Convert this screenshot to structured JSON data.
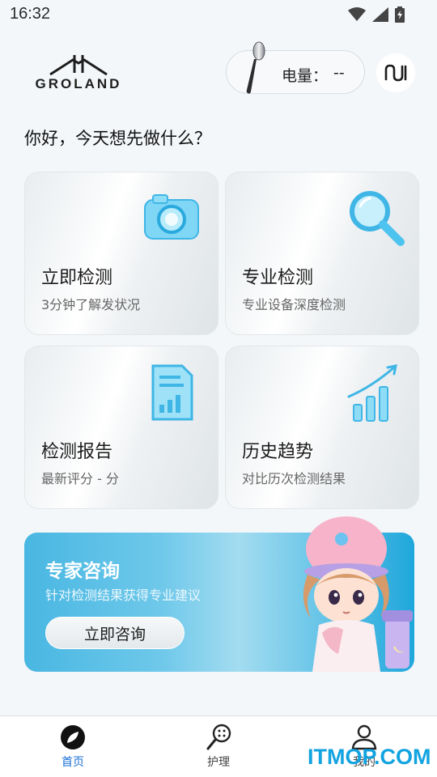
{
  "status": {
    "time": "16:32"
  },
  "brand": {
    "name": "GROLAND"
  },
  "battery": {
    "label": "电量：",
    "value": "--"
  },
  "greeting": "你好，今天想先做什么？",
  "cards": [
    {
      "title": "立即检测",
      "subtitle": "3分钟了解发状况",
      "icon": "camera-icon"
    },
    {
      "title": "专业检测",
      "subtitle": "专业设备深度检测",
      "icon": "magnifier-icon"
    },
    {
      "title": "检测报告",
      "subtitle": "最新评分 - 分",
      "icon": "report-document-icon"
    },
    {
      "title": "历史趋势",
      "subtitle": "对比历次检测结果",
      "icon": "trend-chart-icon"
    }
  ],
  "banner": {
    "title": "专家咨询",
    "subtitle": "针对检测结果获得专业建议",
    "button": "立即咨询"
  },
  "nav": [
    {
      "label": "首页",
      "active": true
    },
    {
      "label": "护理",
      "active": false
    },
    {
      "label": "我的",
      "active": false
    }
  ],
  "watermark": "ITMOP.COM",
  "colors": {
    "accent": "#1a6fd6",
    "banner": "#49b7e2",
    "icon_blue": "#4ec3ef"
  }
}
